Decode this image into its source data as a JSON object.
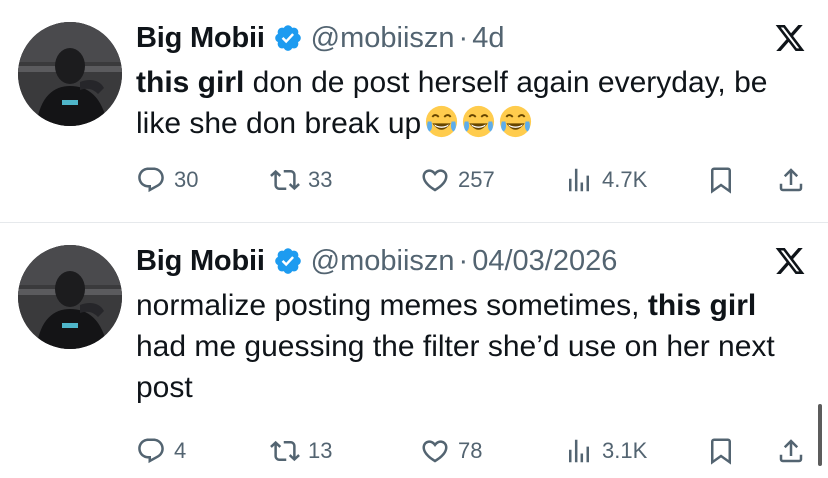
{
  "tweets": [
    {
      "author": "Big Mobii",
      "handle": "@mobiiszn",
      "separator": "·",
      "time": "4d",
      "text_segments": [
        {
          "text": "this girl",
          "bold": true
        },
        {
          "text": " don de post herself again everyday, be like she don break up",
          "bold": false
        }
      ],
      "emojis": [
        "face-with-tears-of-joy",
        "face-with-tears-of-joy",
        "face-with-tears-of-joy"
      ],
      "stats": {
        "replies": "30",
        "reposts": "33",
        "likes": "257",
        "views": "4.7K"
      }
    },
    {
      "author": "Big Mobii",
      "handle": "@mobiiszn",
      "separator": "·",
      "time": "04/03/2026",
      "text_segments": [
        {
          "text": "normalize posting memes sometimes, ",
          "bold": false
        },
        {
          "text": "this girl",
          "bold": true
        },
        {
          "text": " had me guessing the filter she’d use on her next post",
          "bold": false
        }
      ],
      "emojis": [],
      "stats": {
        "replies": "4",
        "reposts": "13",
        "likes": "78",
        "views": "3.1K"
      }
    }
  ],
  "icons": {
    "verified": "verified-badge-icon",
    "platform": "x-logo-icon",
    "reply": "reply-icon",
    "repost": "repost-icon",
    "like": "heart-icon",
    "views": "views-chart-icon",
    "bookmark": "bookmark-icon",
    "share": "share-icon"
  },
  "colors": {
    "text": "#0f1419",
    "secondary": "#536471",
    "verified": "#1d9bf0",
    "divider": "#e6e9ec"
  }
}
